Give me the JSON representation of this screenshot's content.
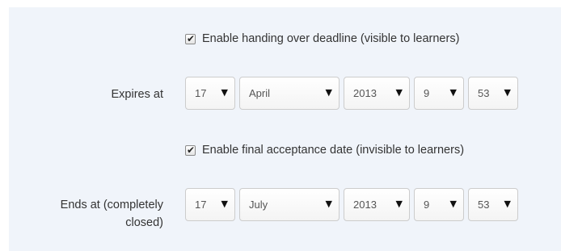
{
  "deadline": {
    "checkbox_checked": true,
    "checkbox_label": "Enable handing over deadline (visible to learners)",
    "field_label": "Expires at",
    "day": "17",
    "month": "April",
    "year": "2013",
    "hour": "9",
    "minute": "53"
  },
  "final_acceptance": {
    "checkbox_checked": true,
    "checkbox_label": "Enable final acceptance date (invisible to learners)",
    "field_label_line1": "Ends at (completely",
    "field_label_line2": "closed)",
    "day": "17",
    "month": "July",
    "year": "2013",
    "hour": "9",
    "minute": "53"
  },
  "icons": {
    "checkmark": "checkmark-icon",
    "dropdown": "caret-down-icon"
  },
  "colors": {
    "panel_background": "#f0f4fa",
    "select_border": "#cccccc",
    "text": "#333333"
  }
}
